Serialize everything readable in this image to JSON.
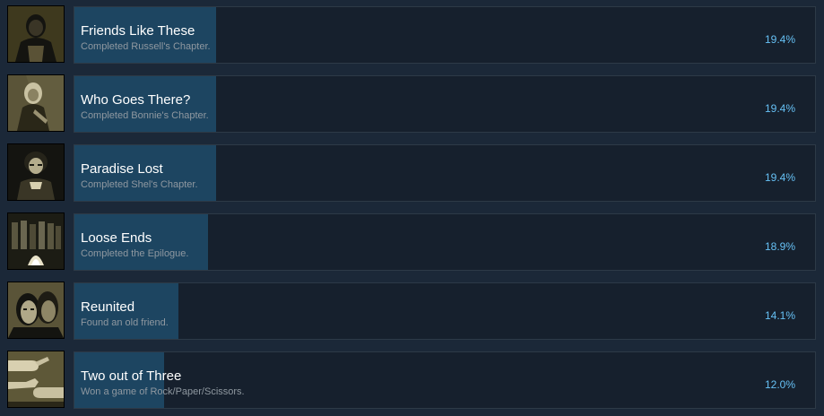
{
  "colors": {
    "page_background": "#1b2838",
    "panel_background": "#16202d",
    "progress_fill": "#1d4561",
    "title_text": "#ffffff",
    "description_text": "#8f98a0",
    "percent_text": "#66c0f4"
  },
  "achievements": [
    {
      "title": "Friends Like These",
      "description": "Completed Russell's Chapter.",
      "percent": "19.4%",
      "percent_value": 19.4,
      "icon": "russell-portrait-icon"
    },
    {
      "title": "Who Goes There?",
      "description": "Completed Bonnie's Chapter.",
      "percent": "19.4%",
      "percent_value": 19.4,
      "icon": "bonnie-portrait-icon"
    },
    {
      "title": "Paradise Lost",
      "description": "Completed Shel's Chapter.",
      "percent": "19.4%",
      "percent_value": 19.4,
      "icon": "shel-portrait-icon"
    },
    {
      "title": "Loose Ends",
      "description": "Completed the Epilogue.",
      "percent": "18.9%",
      "percent_value": 18.9,
      "icon": "campfire-group-icon"
    },
    {
      "title": "Reunited",
      "description": "Found an old friend.",
      "percent": "14.1%",
      "percent_value": 14.1,
      "icon": "two-faces-icon"
    },
    {
      "title": "Two out of Three",
      "description": "Won a game of Rock/Paper/Scissors.",
      "percent": "12.0%",
      "percent_value": 12.0,
      "icon": "hands-game-icon"
    }
  ]
}
